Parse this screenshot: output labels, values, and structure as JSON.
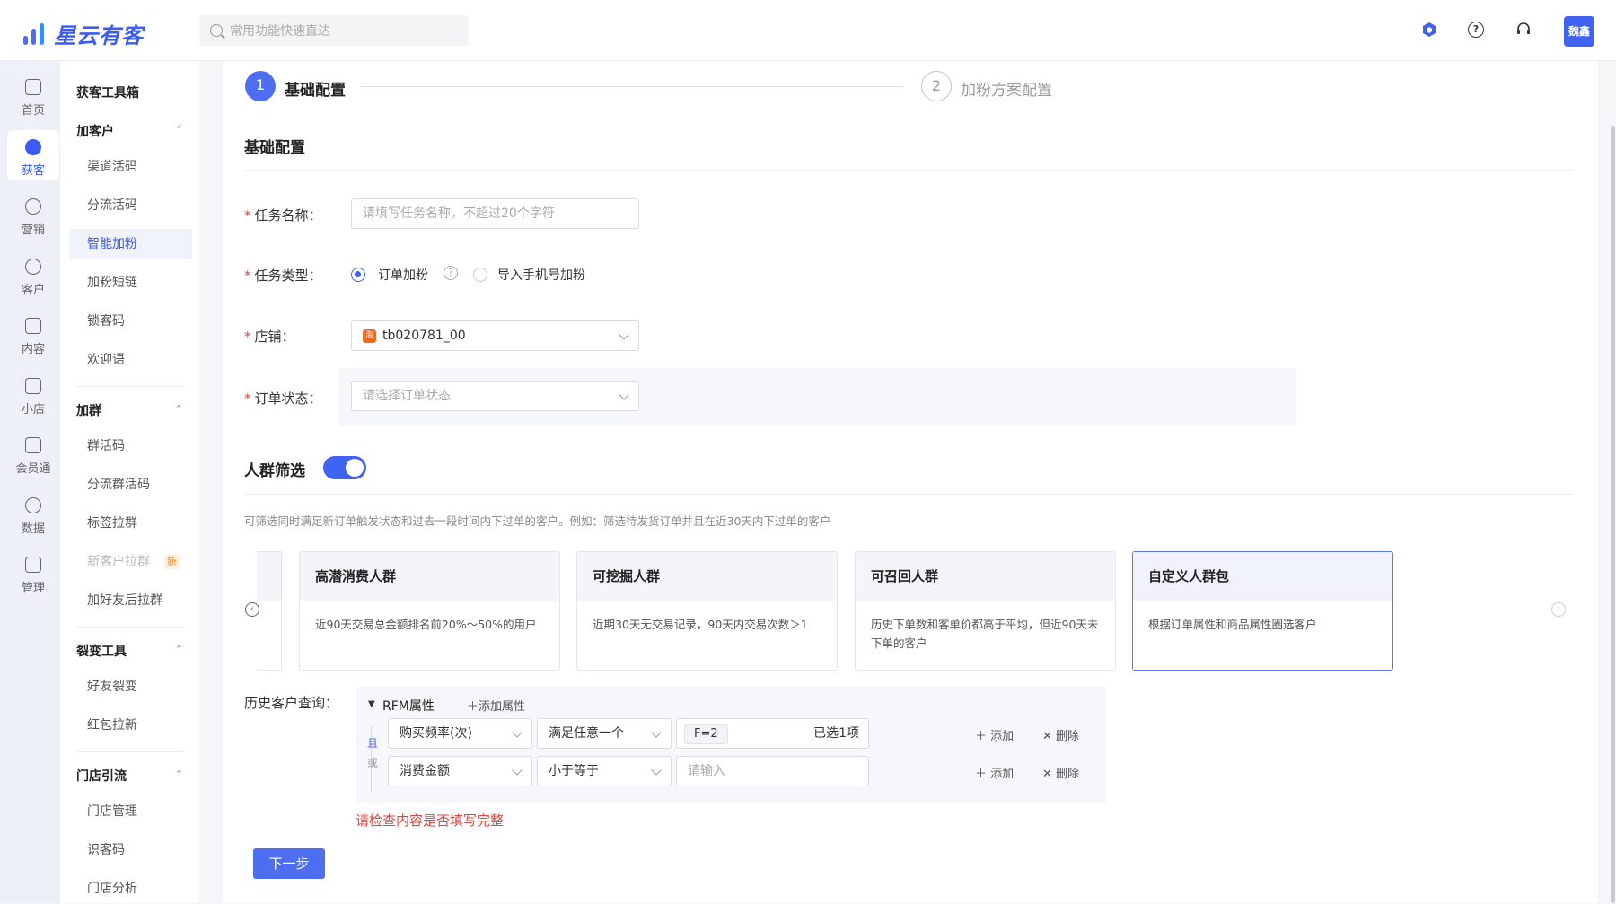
{
  "app": {
    "name": "星云有客"
  },
  "search": {
    "placeholder": "常用功能快速直达"
  },
  "header": {
    "avatar_text": "魏鑫",
    "icons": [
      "cube-icon",
      "help-icon",
      "headset-icon"
    ]
  },
  "rail": [
    {
      "label": "首页",
      "icon": "home-icon"
    },
    {
      "label": "获客",
      "icon": "add-user-icon",
      "active": true
    },
    {
      "label": "营销",
      "icon": "bulb-icon"
    },
    {
      "label": "客户",
      "icon": "user-icon"
    },
    {
      "label": "内容",
      "icon": "folder-icon"
    },
    {
      "label": "小店",
      "icon": "shop-icon"
    },
    {
      "label": "会员通",
      "icon": "member-icon"
    },
    {
      "label": "数据",
      "icon": "pie-icon"
    },
    {
      "label": "管理",
      "icon": "grid-icon"
    }
  ],
  "submenu": {
    "title": "获客工具箱",
    "groups": [
      {
        "label": "加客户",
        "items": [
          "渠道活码",
          "分流活码",
          "智能加粉",
          "加粉短链",
          "锁客码",
          "欢迎语"
        ]
      },
      {
        "label": "加群",
        "items": [
          "群活码",
          "分流群活码",
          "标签拉群",
          "新客户拉群",
          "加好友后拉群"
        ]
      },
      {
        "label": "裂变工具",
        "items": [
          "好友裂变",
          "红包拉新"
        ]
      },
      {
        "label": "门店引流",
        "items": [
          "门店管理",
          "识客码",
          "门店分析"
        ]
      }
    ],
    "new_tag": "新"
  },
  "steps": [
    {
      "num": "1",
      "label": "基础配置"
    },
    {
      "num": "2",
      "label": "加粉方案配置"
    }
  ],
  "form": {
    "section_title": "基础配置",
    "task_name": {
      "label": "任务名称：",
      "placeholder": "请填写任务名称，不超过20个字符"
    },
    "task_type": {
      "label": "任务类型：",
      "option1": "订单加粉",
      "option2": "导入手机号加粉",
      "help": "?"
    },
    "shop": {
      "label": "店铺：",
      "value": "tb020781_00",
      "badge": "淘"
    },
    "order_status": {
      "label": "订单状态：",
      "placeholder": "请选择订单状态"
    }
  },
  "crowd": {
    "title": "人群筛选",
    "desc": "可筛选同时满足新订单触发状态和过去一段时间内下过单的客户。例如：筛选待发货订单并且在近30天内下过单的客户",
    "cards": [
      {
        "title": "高潜消费人群",
        "desc": "近90天交易总金额排名前20%～50%的用户"
      },
      {
        "title": "可挖掘人群",
        "desc": "近期30天无交易记录，90天内交易次数＞1"
      },
      {
        "title": "可召回人群",
        "desc": "历史下单数和客单价都高于平均，但近90天未下单的客户"
      },
      {
        "title": "自定义人群包",
        "desc": "根据订单属性和商品属性圈选客户"
      }
    ],
    "prev_arrow": "‹",
    "next_arrow": "›"
  },
  "history": {
    "label": "历史客户查询：",
    "rfm_title": "RFM属性",
    "add_attr": "添加属性",
    "and_label": "且",
    "or_label": "或",
    "rows": [
      {
        "field": "购买频率(次)",
        "op": "满足任意一个",
        "value_tag": "F=2",
        "value_count": "已选1项"
      },
      {
        "field": "消费金额",
        "op": "小于等于",
        "placeholder": "请输入"
      }
    ],
    "add": "添加",
    "del": "删除"
  },
  "error_text": "请检查内容是否填写完整",
  "next_button": "下一步",
  "colors": {
    "accent": "#3f63f2",
    "error": "#e8433a"
  }
}
